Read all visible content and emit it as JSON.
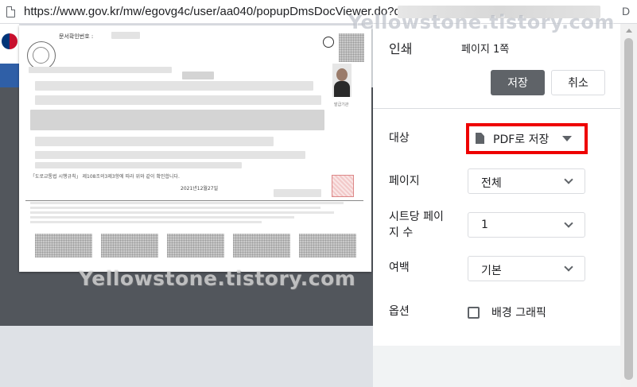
{
  "browser": {
    "url": "https://www.gov.kr/mw/egovg4c/user/aa040/popupDmsDocViewer.do?q=",
    "url_trailing": "D"
  },
  "watermark": {
    "text": "Yellowstone.tistory.com"
  },
  "document": {
    "number_label": "문서확인번호 :",
    "note_line": "「도로교통법 시행규칙」 제108조의3제3항에 따라 위와 같이 확인합니다.",
    "date": "2021년12월27일",
    "small_label": "발급기관"
  },
  "print_panel": {
    "title": "인쇄",
    "page_count": "페이지 1쪽",
    "save_label": "저장",
    "cancel_label": "취소",
    "destination": {
      "label": "대상",
      "value": "PDF로 저장",
      "highlight_color": "#ee0000"
    },
    "pages": {
      "label": "페이지",
      "value": "전체"
    },
    "pages_per_sheet": {
      "label": "시트당 페이\n지 수",
      "value": "1"
    },
    "margins": {
      "label": "여백",
      "value": "기본"
    },
    "options": {
      "label": "옵션",
      "checkbox_label": "배경 그래픽",
      "checked": false
    }
  }
}
